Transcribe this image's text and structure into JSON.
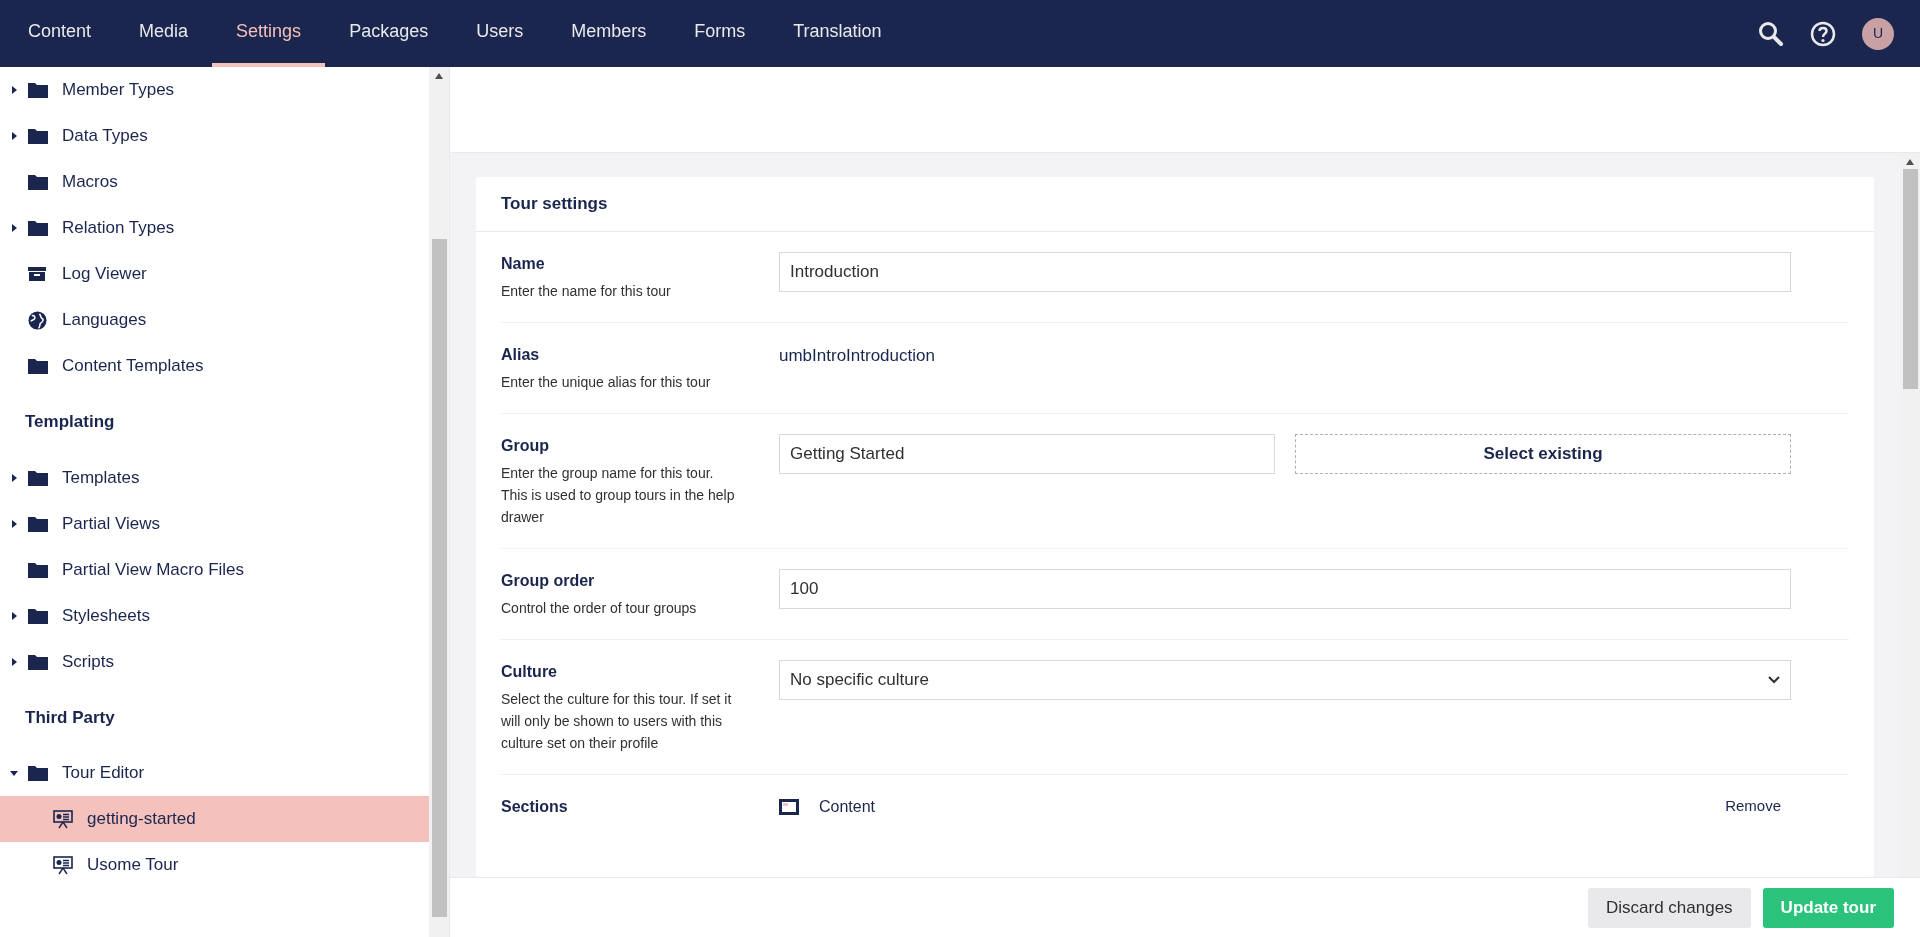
{
  "nav": {
    "tabs": [
      {
        "label": "Content",
        "selected": false
      },
      {
        "label": "Media",
        "selected": false
      },
      {
        "label": "Settings",
        "selected": true
      },
      {
        "label": "Packages",
        "selected": false
      },
      {
        "label": "Users",
        "selected": false
      },
      {
        "label": "Members",
        "selected": false
      },
      {
        "label": "Forms",
        "selected": false
      },
      {
        "label": "Translation",
        "selected": false
      }
    ],
    "avatar": "U"
  },
  "sidebar": {
    "groups": [
      {
        "items": [
          {
            "label": "Member Types",
            "kind": "folder",
            "expanded": false,
            "selected": false
          },
          {
            "label": "Data Types",
            "kind": "folder",
            "expanded": false,
            "selected": false
          },
          {
            "label": "Macros",
            "kind": "folder",
            "selected": false
          },
          {
            "label": "Relation Types",
            "kind": "folder",
            "expanded": false,
            "selected": false
          },
          {
            "label": "Log Viewer",
            "kind": "archive",
            "selected": false
          },
          {
            "label": "Languages",
            "kind": "globe",
            "selected": false
          },
          {
            "label": "Content Templates",
            "kind": "folder",
            "selected": false
          }
        ]
      },
      {
        "title": "Templating",
        "items": [
          {
            "label": "Templates",
            "kind": "folder",
            "expanded": false,
            "selected": false
          },
          {
            "label": "Partial Views",
            "kind": "folder",
            "expanded": false,
            "selected": false
          },
          {
            "label": "Partial View Macro Files",
            "kind": "folder",
            "selected": false
          },
          {
            "label": "Stylesheets",
            "kind": "folder",
            "expanded": false,
            "selected": false
          },
          {
            "label": "Scripts",
            "kind": "folder",
            "expanded": false,
            "selected": false
          }
        ]
      },
      {
        "title": "Third Party",
        "items": [
          {
            "label": "Tour Editor",
            "kind": "folder",
            "expanded": true,
            "selected": false,
            "children": [
              {
                "label": "getting-started",
                "kind": "tour",
                "selected": true
              },
              {
                "label": "Usome Tour",
                "kind": "tour",
                "selected": false
              }
            ]
          }
        ]
      }
    ]
  },
  "card": {
    "title": "Tour settings",
    "fields": [
      {
        "label": "Name",
        "description": "Enter the name for this tour",
        "kind": "text",
        "value": "Introduction"
      },
      {
        "label": "Alias",
        "description": "Enter the unique alias for this tour",
        "kind": "static",
        "value": "umbIntroIntroduction"
      },
      {
        "label": "Group",
        "description": "Enter the group name for this tour. This is used to group tours in the help drawer",
        "kind": "text-button",
        "value": "Getting Started",
        "button": "Select existing"
      },
      {
        "label": "Group order",
        "description": "Control the order of tour groups",
        "kind": "text",
        "value": "100"
      },
      {
        "label": "Culture",
        "description": "Select the culture for this tour. If set it will only be shown to users with this culture set on their profile",
        "kind": "select",
        "value": "No specific culture"
      },
      {
        "label": "Sections",
        "kind": "section-list",
        "value": "Content",
        "button": "Remove"
      }
    ]
  },
  "footer": {
    "buttons": [
      {
        "label": "Discard changes",
        "kind": "secondary"
      },
      {
        "label": "Update tour",
        "kind": "primary"
      }
    ]
  }
}
